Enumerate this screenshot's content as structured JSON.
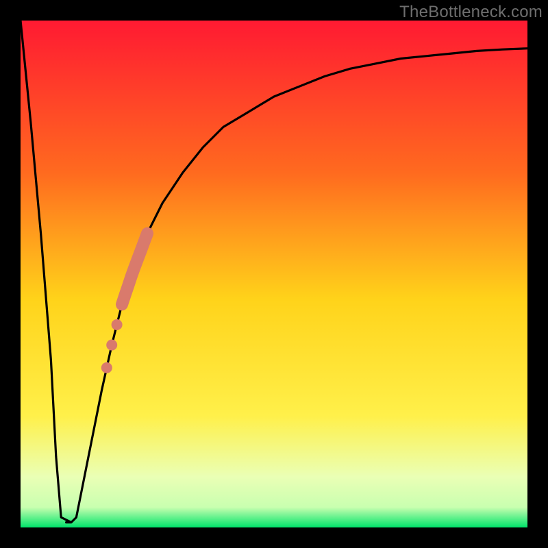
{
  "watermark": "TheBottleneck.com",
  "colors": {
    "frame": "#000000",
    "curve": "#000000",
    "marker": "#d97a6c",
    "gradient_top": "#ff1a32",
    "gradient_upper_mid": "#ff8a1f",
    "gradient_mid": "#ffd31a",
    "gradient_lower_mid": "#f6ff6e",
    "gradient_band_pale": "#eaffb5",
    "gradient_bottom": "#00e36a"
  },
  "chart_data": {
    "type": "line",
    "title": "",
    "xlabel": "",
    "ylabel": "",
    "xlim": [
      0,
      100
    ],
    "ylim": [
      0,
      100
    ],
    "grid": false,
    "background": "vertical-gradient red→orange→yellow→pale→green",
    "series": [
      {
        "name": "bottleneck-curve",
        "x": [
          0,
          2,
          4,
          6,
          7,
          8,
          9,
          10,
          11,
          12,
          14,
          16,
          18,
          20,
          22,
          25,
          28,
          32,
          36,
          40,
          45,
          50,
          55,
          60,
          65,
          70,
          75,
          80,
          85,
          90,
          95,
          100
        ],
        "values": [
          100,
          80,
          58,
          33,
          14,
          2,
          1,
          1,
          2,
          7,
          17,
          27,
          36,
          44,
          50,
          58,
          64,
          70,
          75,
          79,
          82,
          85,
          87,
          89,
          90.5,
          91.5,
          92.5,
          93,
          93.5,
          94,
          94.3,
          94.5
        ]
      }
    ],
    "markers": {
      "name": "highlight-segment",
      "points": [
        {
          "x": 17,
          "y": 31,
          "kind": "dot"
        },
        {
          "x": 18,
          "y": 35,
          "kind": "dot"
        },
        {
          "x": 19,
          "y": 40,
          "kind": "dot"
        },
        {
          "x": 20,
          "y": 44,
          "kind": "segment_start"
        },
        {
          "x": 25,
          "y": 58,
          "kind": "segment_end"
        }
      ]
    },
    "valley_flat": {
      "x_start": 8,
      "x_end": 10,
      "y": 1
    }
  }
}
